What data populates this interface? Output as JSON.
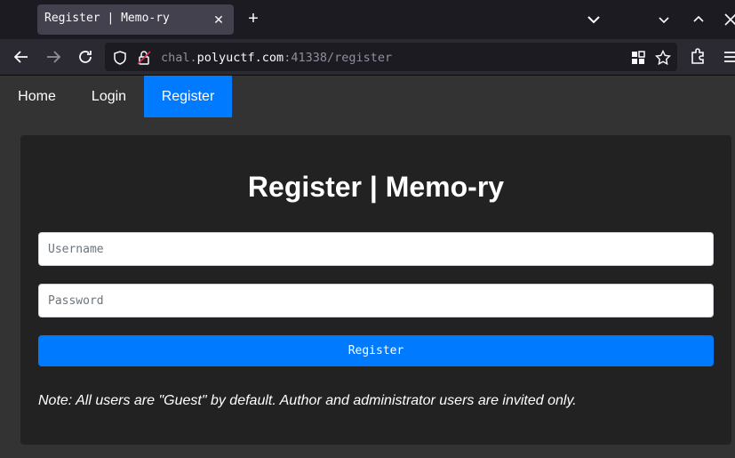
{
  "browser": {
    "tab_title": "Register | Memo-ry",
    "new_tab_label": "+",
    "url": {
      "scheme_prefix": "chal.",
      "host": "polyuctf.com",
      "rest": ":41338/register"
    }
  },
  "nav": {
    "items": [
      {
        "label": "Home"
      },
      {
        "label": "Login"
      },
      {
        "label": "Register",
        "active": true
      }
    ]
  },
  "form": {
    "title": "Register | Memo-ry",
    "username_placeholder": "Username",
    "password_placeholder": "Password",
    "submit_label": "Register",
    "note": "Note: All users are \"Guest\" by default. Author and administrator users are invited only."
  },
  "colors": {
    "accent": "#007bff",
    "page_bg": "#333333",
    "card_bg": "#222222"
  }
}
